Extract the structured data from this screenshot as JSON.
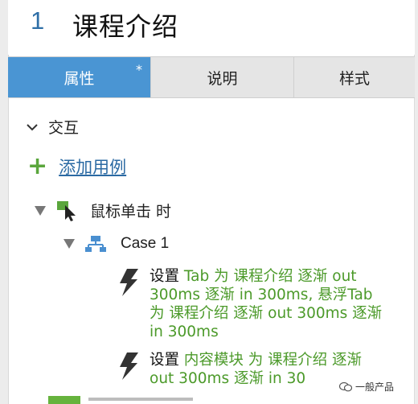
{
  "header": {
    "index": "1",
    "title": "课程介绍"
  },
  "tabs": [
    {
      "label": "属性",
      "marker": "*"
    },
    {
      "label": "说明"
    },
    {
      "label": "样式"
    }
  ],
  "section": {
    "label": "交互"
  },
  "add_case": {
    "label": "添加用例"
  },
  "event": {
    "label": "鼠标单击 时"
  },
  "case": {
    "label": "Case 1"
  },
  "actions": [
    {
      "verb": "设置",
      "detail": "Tab 为 课程介绍 逐渐 out 300ms 逐渐 in 300ms, 悬浮Tab 为 课程介绍 逐渐 out 300ms 逐渐 in 300ms"
    },
    {
      "verb": "设置",
      "detail": "内容模块 为 课程介绍 逐渐 out 300ms 逐渐 in 30"
    }
  ],
  "watermark": {
    "text": "一般产品"
  },
  "colors": {
    "accent_tab": "#4a95d3",
    "action_green": "#4c9a2a",
    "link_blue": "#2b6aa3",
    "add_green": "#5aa63c"
  }
}
